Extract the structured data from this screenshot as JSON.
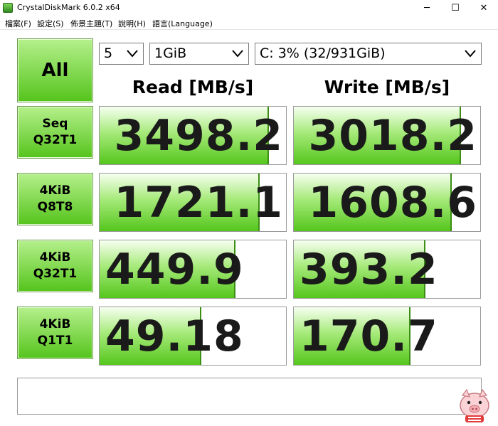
{
  "window": {
    "title": "CrystalDiskMark 6.0.2 x64",
    "minimize_glyph": "─",
    "maximize_glyph": "☐",
    "close_glyph": "✕"
  },
  "menu": [
    "檔案(F)",
    "設定(S)",
    "佈景主題(T)",
    "說明(H)",
    "語言(Language)"
  ],
  "controls": {
    "all_label": "All",
    "count_value": "5",
    "size_value": "1GiB",
    "drive_value": "C: 3% (32/931GiB)"
  },
  "headers": {
    "read": "Read [MB/s]",
    "write": "Write [MB/s]"
  },
  "tests": [
    {
      "line1": "Seq",
      "line2": "Q32T1",
      "read": "3498.2",
      "write": "3018.2",
      "read_level": 0.9,
      "write_level": 0.89
    },
    {
      "line1": "4KiB",
      "line2": "Q8T8",
      "read": "1721.1",
      "write": "1608.6",
      "read_level": 0.85,
      "write_level": 0.84
    },
    {
      "line1": "4KiB",
      "line2": "Q32T1",
      "read": "449.9",
      "write": "393.2",
      "read_level": 0.72,
      "write_level": 0.7
    },
    {
      "line1": "4KiB",
      "line2": "Q1T1",
      "read": "49.18",
      "write": "170.7",
      "read_level": 0.54,
      "write_level": 0.62
    }
  ],
  "status_text": "",
  "colors": {
    "accent_green": "#55c41c",
    "bar_border": "#3c8e17"
  },
  "icons": {
    "app": "crystaldiskmark-icon",
    "watermark": "pig-mascot-icon"
  }
}
